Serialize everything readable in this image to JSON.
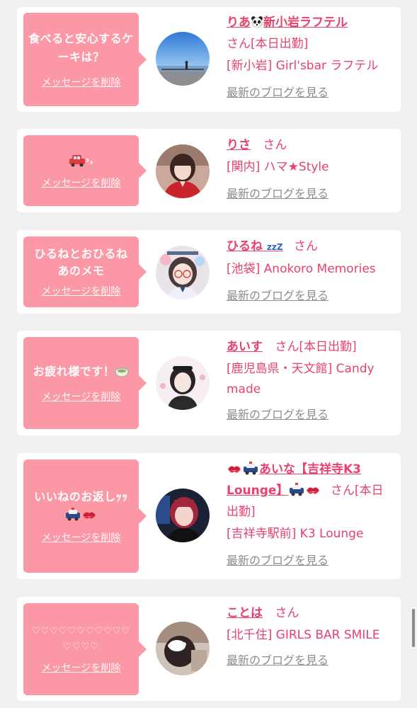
{
  "messages": [
    {
      "message": "食べると安心するケーキは？",
      "delete_label": "メッセージを削除",
      "name": "りあ",
      "name_suffix": "新小岩ラフテル",
      "san": "さん",
      "status": "[本日出勤]",
      "shop": "[新小岩] Girl'sbar ラフテル",
      "blog_label": "最新のブログを見る",
      "avatar": "seaside-photo"
    },
    {
      "message": "³₃",
      "delete_label": "メッセージを削除",
      "name": "りさ",
      "name_suffix": "",
      "san": "さん",
      "status": "",
      "shop": "[関内] ハマ★Style",
      "blog_label": "最新のブログを見る",
      "avatar": "girl-red-photo"
    },
    {
      "message": "ひるねとおひるね あのメモ",
      "delete_label": "メッセージを削除",
      "name": "ひるね",
      "name_suffix": "zzZ",
      "san": "さん",
      "status": "",
      "shop": "[池袋] Anokoro Memories",
      "blog_label": "最新のブログを見る",
      "avatar": "glasses-girl-photo"
    },
    {
      "message": "お疲れ様です！",
      "delete_label": "メッセージを削除",
      "name": "あいす",
      "name_suffix": "",
      "san": "さん",
      "status": "[本日出勤]",
      "shop": "[鹿児島県・天文館] Candy made",
      "blog_label": "最新のブログを見る",
      "avatar": "twin-tail-girl-photo"
    },
    {
      "message": "いいねのお返しｯｯ",
      "delete_label": "メッセージを削除",
      "name": "あいな【吉祥寺K3 Lounge】",
      "name_suffix": "",
      "san": "さん",
      "status": "[本日出勤]",
      "shop": "[吉祥寺駅前] K3 Lounge",
      "blog_label": "最新のブログを見る",
      "avatar": "red-hair-girl-photo"
    },
    {
      "message": "♡♡♡♡♡♡♡♡♡♡♡♡♡♡♡",
      "delete_label": "メッセージを削除",
      "name": "ことは",
      "name_suffix": "",
      "san": "さん",
      "status": "",
      "shop": "[北千住] GIRLS BAR SMILE",
      "blog_label": "最新のブログを見る",
      "avatar": "maid-headdress-photo"
    }
  ],
  "colors": {
    "page_bg": "#f0f0f0",
    "card_bg": "#ffffff",
    "bubble_bg": "#fc97a5",
    "accent": "#e8416c",
    "link_gray": "#8c8c8c"
  }
}
